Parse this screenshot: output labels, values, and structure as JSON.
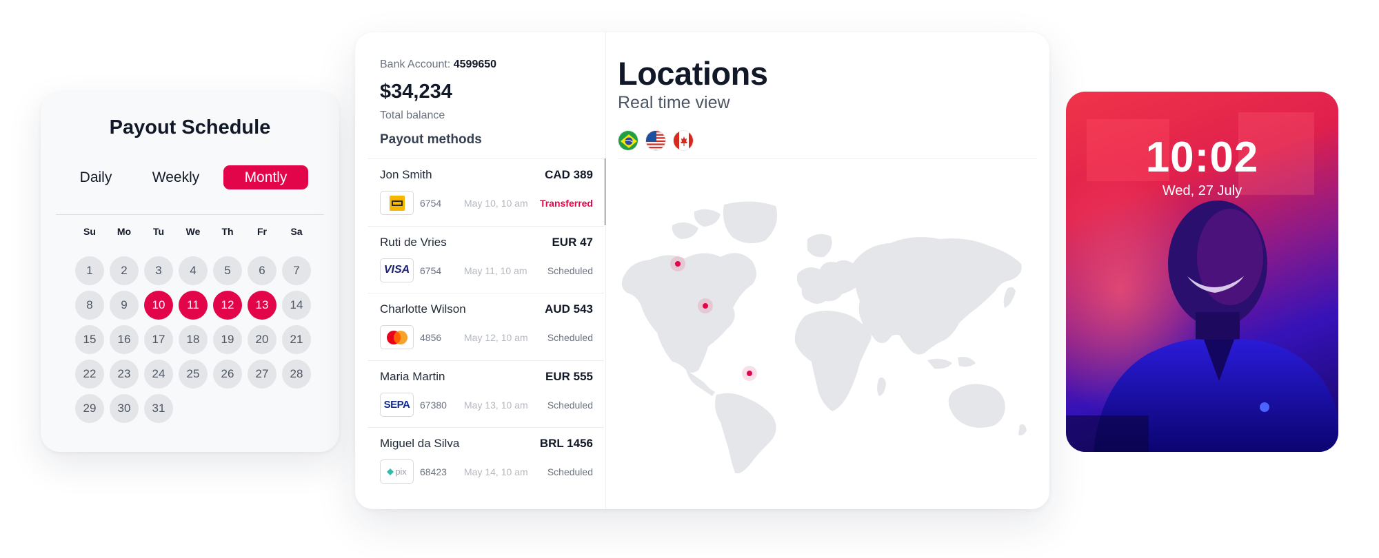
{
  "schedule": {
    "title": "Payout Schedule",
    "tabs": [
      "Daily",
      "Weekly",
      "Montly"
    ],
    "active_tab": "Montly",
    "weekdays": [
      "Su",
      "Mo",
      "Tu",
      "We",
      "Th",
      "Fr",
      "Sa"
    ],
    "days": [
      "1",
      "2",
      "3",
      "4",
      "5",
      "6",
      "7",
      "8",
      "9",
      "10",
      "11",
      "12",
      "13",
      "14",
      "15",
      "16",
      "17",
      "18",
      "19",
      "20",
      "21",
      "22",
      "23",
      "24",
      "25",
      "26",
      "27",
      "28",
      "29",
      "30",
      "31"
    ],
    "selected_days": [
      "10",
      "11",
      "12",
      "13"
    ]
  },
  "account": {
    "label": "Bank Account:",
    "number": "4599650",
    "balance": "$34,234",
    "balance_label": "Total balance"
  },
  "payouts": {
    "title": "Payout methods",
    "items": [
      {
        "name": "Jon Smith",
        "amount": "CAD 389",
        "method": "interac",
        "last4": "6754",
        "date": "May 10, 10 am",
        "status": "Transferred"
      },
      {
        "name": "Ruti de Vries",
        "amount": "EUR 47",
        "method": "visa",
        "method_label": "VISA",
        "last4": "6754",
        "date": "May 11, 10 am",
        "status": "Scheduled"
      },
      {
        "name": "Charlotte Wilson",
        "amount": "AUD 543",
        "method": "mastercard",
        "last4": "4856",
        "date": "May 12, 10 am",
        "status": "Scheduled"
      },
      {
        "name": "Maria Martin",
        "amount": "EUR 555",
        "method": "sepa",
        "method_label": "SEPA",
        "last4": "67380",
        "date": "May 13, 10 am",
        "status": "Scheduled"
      },
      {
        "name": "Miguel da Silva",
        "amount": "BRL 1456",
        "method": "pix",
        "method_label": "pix",
        "last4": "68423",
        "date": "May 14, 10 am",
        "status": "Scheduled"
      }
    ]
  },
  "locations": {
    "title": "Locations",
    "subtitle": "Real time view",
    "flags": [
      "brazil-flag-icon",
      "usa-flag-icon",
      "canada-flag-icon"
    ],
    "map_icon": "world-map",
    "marker_icon": "location-dot-icon"
  },
  "phone": {
    "time": "10:02",
    "date": "Wed, 27 July"
  },
  "colors": {
    "accent": "#e3054a",
    "text": "#111827",
    "muted": "#6b7280",
    "map_land": "#e5e6e9"
  }
}
